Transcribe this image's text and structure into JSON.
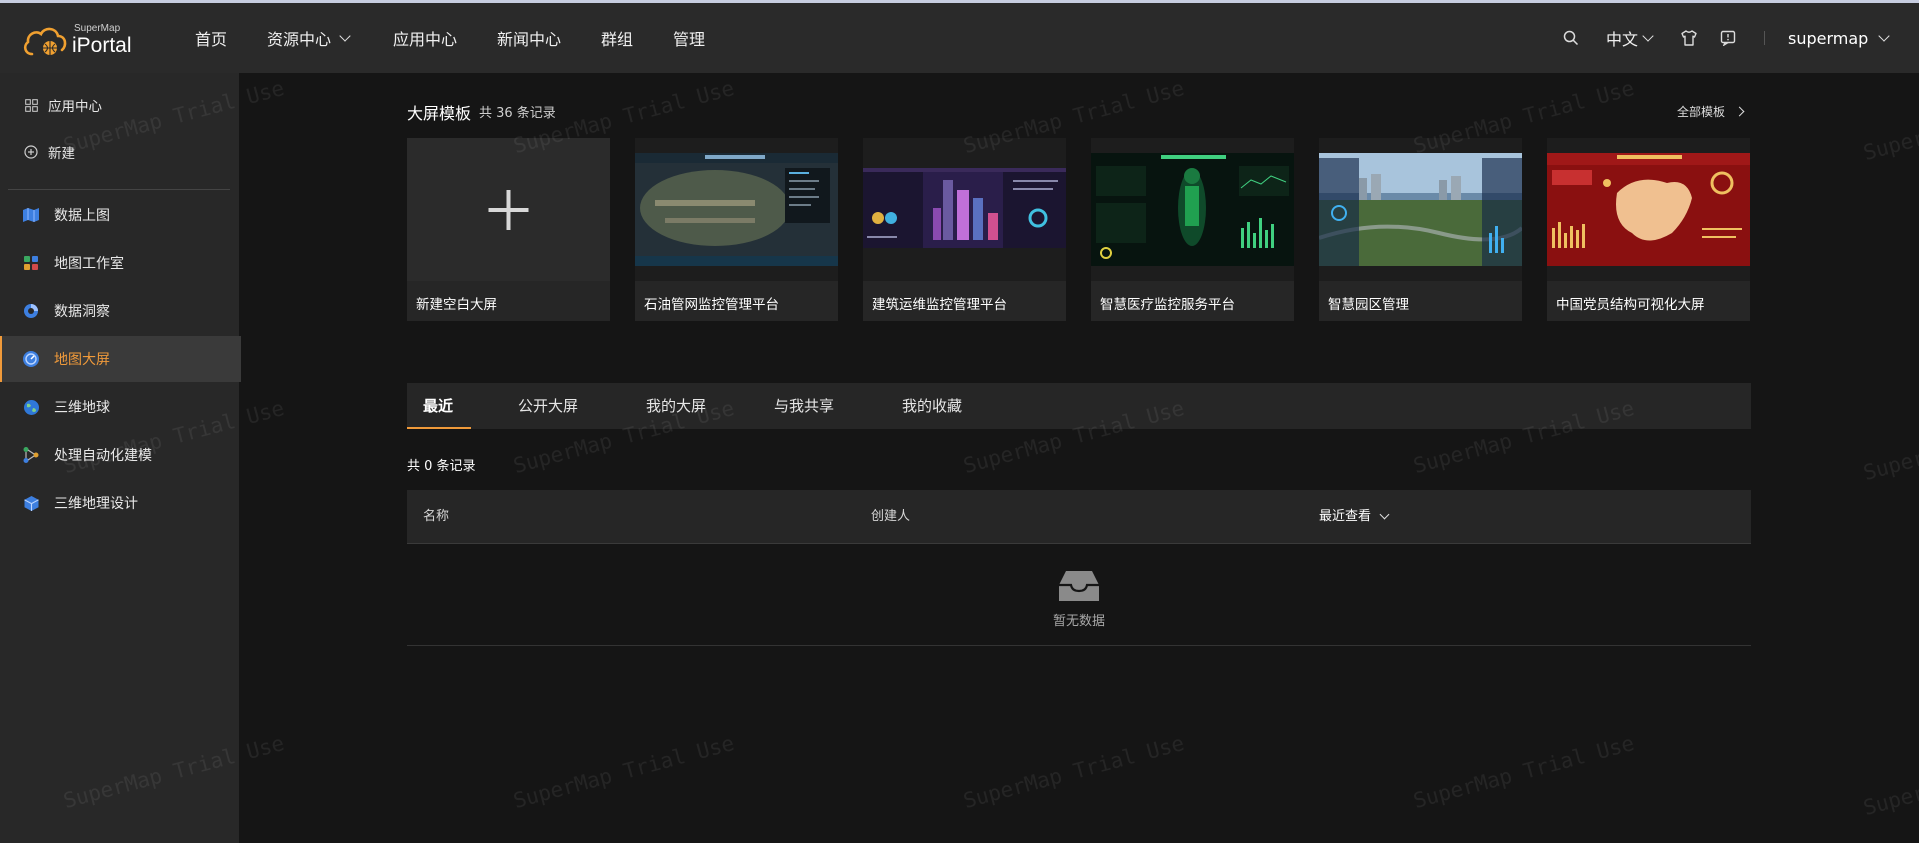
{
  "header": {
    "brand_small": "SuperMap",
    "brand_big": "iPortal",
    "nav": [
      {
        "label": "首页"
      },
      {
        "label": "资源中心"
      },
      {
        "label": "应用中心"
      },
      {
        "label": "新闻中心"
      },
      {
        "label": "群组"
      },
      {
        "label": "管理"
      }
    ],
    "language": "中文",
    "user": "supermap"
  },
  "sidebar": {
    "top_items": [
      {
        "label": "应用中心",
        "icon": "grid-icon"
      },
      {
        "label": "新建",
        "icon": "plus-circle-icon"
      }
    ],
    "items": [
      {
        "label": "数据上图",
        "icon": "map-icon"
      },
      {
        "label": "地图工作室",
        "icon": "studio-icon"
      },
      {
        "label": "数据洞察",
        "icon": "pie-chart-icon"
      },
      {
        "label": "地图大屏",
        "icon": "dashboard-icon",
        "active": true
      },
      {
        "label": "三维地球",
        "icon": "globe-icon"
      },
      {
        "label": "处理自动化建模",
        "icon": "workflow-icon"
      },
      {
        "label": "三维地理设计",
        "icon": "cube-icon"
      }
    ],
    "accent_color": "#f09a3a"
  },
  "templates": {
    "title": "大屏模板",
    "count": "共 36 条记录",
    "all_link": "全部模板",
    "cards": [
      {
        "label": "新建空白大屏",
        "icon": "plus-icon"
      },
      {
        "label": "石油管网监控管理平台"
      },
      {
        "label": "建筑运维监控管理平台"
      },
      {
        "label": "智慧医疗监控服务平台"
      },
      {
        "label": "智慧园区管理"
      },
      {
        "label": "中国党员结构可视化大屏"
      }
    ]
  },
  "tabs": [
    {
      "label": "最近",
      "active": true
    },
    {
      "label": "公开大屏"
    },
    {
      "label": "我的大屏"
    },
    {
      "label": "与我共享"
    },
    {
      "label": "我的收藏"
    }
  ],
  "records": "共 0 条记录",
  "table": {
    "columns": [
      {
        "label": "名称"
      },
      {
        "label": "创建人"
      },
      {
        "label": "最近查看"
      }
    ],
    "empty_text": "暂无数据"
  },
  "watermark": "SuperMap Trial Use"
}
